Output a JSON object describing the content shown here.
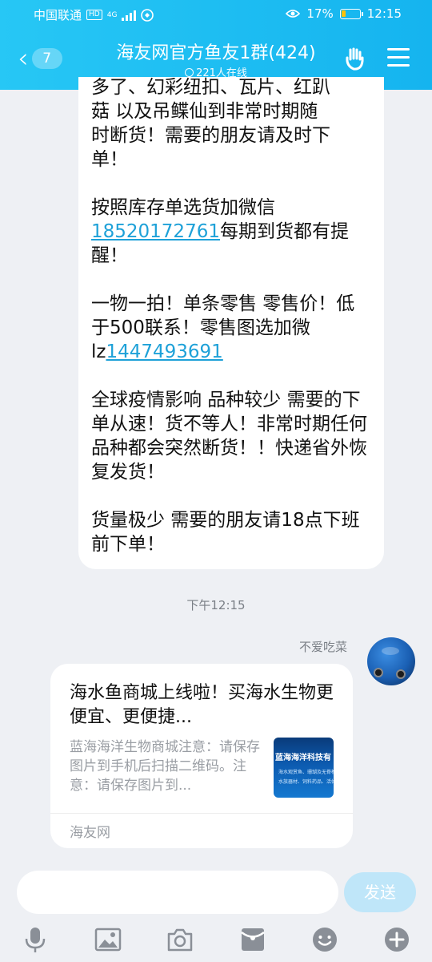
{
  "status_bar": {
    "carrier": "中国联通",
    "network_badge": "HD",
    "network_type": "4G",
    "battery_percent": "17%",
    "time": "12:15"
  },
  "header": {
    "unread_count": "7",
    "title": "海友网官方鱼友1群(424)",
    "online": "221人在线"
  },
  "messages": {
    "m1": {
      "line1": "多了、幻彩纽扣、瓦片、红趴",
      "line2": "菇 以及吊鲽仙到非常时期随",
      "line3": "时断货！需要的朋友请及时下",
      "line4": "单！",
      "p2_a": "按照库存单选货加微信",
      "p2_link": "18520172761",
      "p2_b": "每期到货都有提醒！",
      "p3_a": "一物一拍！单条零售 零售价！低于500联系！零售图选加微lz",
      "p3_link": "1447493691",
      "p4": "全球疫情影响 品种较少 需要的下单从速！货不等人！非常时期任何品种都会突然断货！！快递省外恢复发货！",
      "p5": "货量极少 需要的朋友请18点下班前下单！"
    },
    "timestamp": "下午12:15",
    "m2": {
      "sender": "不爱吃菜",
      "card_title": "海水鱼商城上线啦！买海水生物更便宜、更便捷...",
      "card_desc": "蓝海海洋生物商城注意：请保存图片到手机后扫描二维码。注意：请保存图片到...",
      "thumb_title": "蓝海海洋科技有",
      "thumb_line1": "海水观赏鱼、珊瑚及无脊椎",
      "thumb_line2": "水族器材、饲料药品、活体配送",
      "card_source": "海友网"
    }
  },
  "input": {
    "placeholder": "",
    "send_label": "发送"
  },
  "colors": {
    "header": "#1ab8f0",
    "link": "#1ea1d8",
    "send_disabled": "#bfe6f9",
    "badge_dot": "#f04a3e"
  }
}
